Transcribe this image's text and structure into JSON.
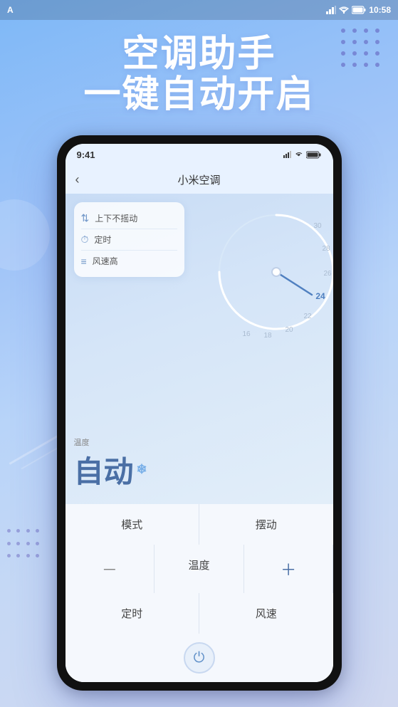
{
  "status_bar": {
    "app_label": "A",
    "time": "10:58"
  },
  "hero": {
    "line1": "空调助手",
    "line2": "一键自动开启"
  },
  "phone": {
    "status_time": "9:41",
    "header_back": "‹",
    "header_title": "小米空调",
    "controls": [
      {
        "icon": "↕",
        "label": "上下不摇动"
      },
      {
        "icon": "⏱",
        "label": "定时"
      },
      {
        "icon": "≡",
        "label": "风速高"
      }
    ],
    "dial_numbers": [
      "28",
      "30",
      "26",
      "24",
      "22",
      "20",
      "18",
      "16"
    ],
    "dial_highlight": "24",
    "temp_label": "温度",
    "temp_value": "自动",
    "buttons_row1": [
      "模式",
      "摆动"
    ],
    "buttons_row2_minus": "－",
    "buttons_row2_label": "温度",
    "buttons_row2_plus": "＋",
    "buttons_row3": [
      "定时",
      "风速"
    ],
    "power_icon": "⏻"
  }
}
